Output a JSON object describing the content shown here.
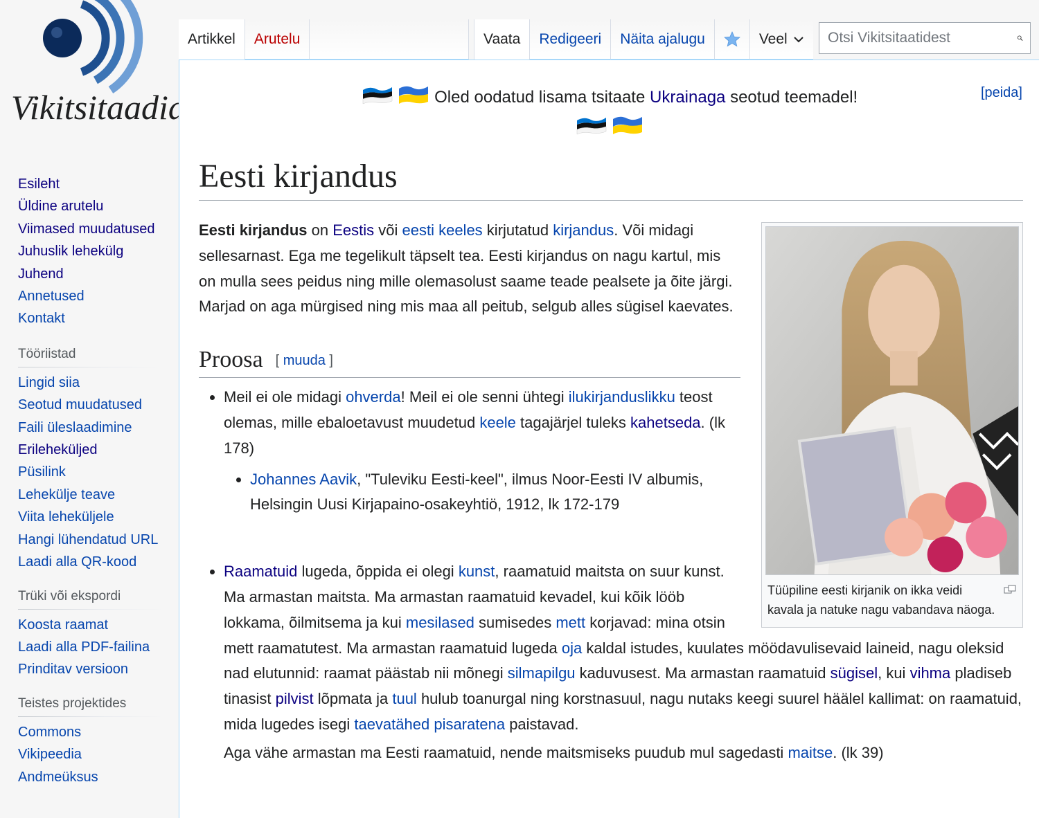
{
  "logo": {
    "wordmark": "Vikitsitaadid"
  },
  "sidebar": {
    "navigation": [
      {
        "label": "Esileht",
        "visited": true
      },
      {
        "label": "Üldine arutelu",
        "visited": true
      },
      {
        "label": "Viimased muudatused",
        "visited": true
      },
      {
        "label": "Juhuslik lehekülg",
        "visited": true
      },
      {
        "label": "Juhend",
        "visited": true
      },
      {
        "label": "Annetused",
        "visited": false
      },
      {
        "label": "Kontakt",
        "visited": false
      }
    ],
    "tools": {
      "heading": "Tööriistad",
      "items": [
        "Lingid siia",
        "Seotud muudatused",
        "Faili üleslaadimine",
        "Erileheküljed",
        "Püsilink",
        "Lehekülje teave",
        "Viita leheküljele",
        "Hangi lühendatud URL",
        "Laadi alla QR-kood"
      ]
    },
    "print": {
      "heading": "Trüki või ekspordi",
      "items": [
        "Koosta raamat",
        "Laadi alla PDF-failina",
        "Prinditav versioon"
      ]
    },
    "projects": {
      "heading": "Teistes projektides",
      "items": [
        "Commons",
        "Vikipeedia",
        "Andmeüksus"
      ]
    }
  },
  "tabs": {
    "article": "Artikkel",
    "talk": "Arutelu",
    "view": "Vaata",
    "edit": "Redigeeri",
    "history": "Näita ajalugu",
    "more": "Veel"
  },
  "search": {
    "placeholder": "Otsi Vikitsitaatidest"
  },
  "notice": {
    "before": "Oled oodatud lisama tsitaate ",
    "link": "Ukrainaga",
    "after": " seotud teemadel!",
    "hide": "[peida]"
  },
  "page": {
    "title": "Eesti kirjandus",
    "intro": {
      "bold": "Eesti kirjandus",
      "t1": " on ",
      "l1": "Eestis",
      "t2": " või ",
      "l2": "eesti keeles",
      "t3": " kirjutatud ",
      "l3": "kirjandus",
      "t4": ". Või midagi sellesarnast. Ega me tegelikult täpselt tea. Eesti kirjandus on nagu kartul, mis on mulla sees peidus ning mille olemasolust saame teade pealsete ja õite järgi. Marjad on aga mürgised ning mis maa all peitub, selgub alles sügisel kaevates."
    },
    "thumb": {
      "caption": "Tüüpiline eesti kirjanik on ikka veidi kavala ja natuke nagu vabandava näoga."
    },
    "section": {
      "title": "Proosa",
      "edit": "muuda"
    },
    "quote1": {
      "t1": "Meil ei ole midagi ",
      "l1": "ohverda",
      "t2": "! Meil ei ole senni ühtegi ",
      "l2": "ilukirjanduslikku",
      "t3": " teost olemas, mille ebaloetavust muudetud ",
      "l3": "keele",
      "t4": " tagajärjel tuleks ",
      "l4": "kahetseda",
      "t5": ". (lk 178)",
      "source_link": "Johannes Aavik",
      "source_text": ", \"Tuleviku Eesti-keel\", ilmus Noor-Eesti IV albumis, Helsingin Uusi Kirjapaino-osakeyhtiö, 1912, lk 172-179"
    },
    "quote2": {
      "l1": "Raamatuid",
      "t1": " lugeda, õppida ei olegi ",
      "l2": "kunst",
      "t2": ", raamatuid maitsta on suur kunst. Ma armastan maitsta. Ma armastan raamatuid kevadel, kui kõik lööb lokkama, õilmitsema ja kui ",
      "l3": "mesilased",
      "t3": " sumisedes ",
      "l4": "mett",
      "t4": " korjavad: mina otsin mett raamatutest. Ma armastan raamatuid lugeda ",
      "l5": "oja",
      "t5": " kaldal istudes, kuulates möödavulisevaid laineid, nagu oleksid nad elutunnid: raamat päästab nii mõnegi ",
      "l6": "silmapilgu",
      "t6": " kaduvusest. Ma armastan raamatuid ",
      "l7": "sügisel",
      "t7": ", kui ",
      "l8": "vihma",
      "t8": " pladiseb tinasist ",
      "l9": "pilvist",
      "t9": " lõpmata ja ",
      "l10": "tuul",
      "t10": " hulub toanurgal ning korstnasuul, nagu nutaks keegi suurel häälel kallimat: on raamatuid, mida lugedes isegi ",
      "l11": "taevatähed pisaratena",
      "t11": " paistavad.",
      "c1": "Aga vähe armastan ma Eesti raamatuid, nende maitsmiseks puudub mul sagedasti ",
      "cl": "maitse",
      "c2": ". (lk 39)"
    }
  },
  "colors": {
    "link": "#0645ad",
    "visited": "#0b0080",
    "redlink": "#ba0000",
    "border": "#a7d7f9"
  }
}
